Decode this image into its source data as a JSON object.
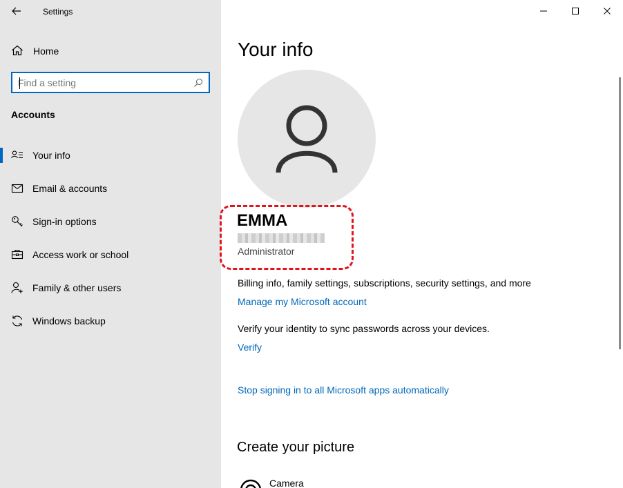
{
  "window": {
    "title": "Settings",
    "controls": [
      "minimize-icon",
      "maximize-icon",
      "close-icon"
    ]
  },
  "sidebar": {
    "home_label": "Home",
    "search_placeholder": "Find a setting",
    "section_heading": "Accounts",
    "items": [
      {
        "label": "Your info",
        "icon": "person-card-icon",
        "selected": true
      },
      {
        "label": "Email & accounts",
        "icon": "mail-icon",
        "selected": false
      },
      {
        "label": "Sign-in options",
        "icon": "key-icon",
        "selected": false
      },
      {
        "label": "Access work or school",
        "icon": "briefcase-icon",
        "selected": false
      },
      {
        "label": "Family & other users",
        "icon": "person-add-icon",
        "selected": false
      },
      {
        "label": "Windows backup",
        "icon": "sync-icon",
        "selected": false
      }
    ]
  },
  "main": {
    "title": "Your info",
    "user": {
      "name": "EMMA",
      "role": "Administrator"
    },
    "billing_text": "Billing info, family settings, subscriptions, security settings, and more",
    "manage_link": "Manage my Microsoft account",
    "verify_text": "Verify your identity to sync passwords across your devices.",
    "verify_link": "Verify",
    "stop_signin_link": "Stop signing in to all Microsoft apps automatically",
    "create_picture_title": "Create your picture",
    "camera_label": "Camera"
  },
  "colors": {
    "accent": "#0067c0",
    "link": "#0067b8",
    "sidebar_bg": "#e6e6e6",
    "highlight": "#e0141e"
  }
}
